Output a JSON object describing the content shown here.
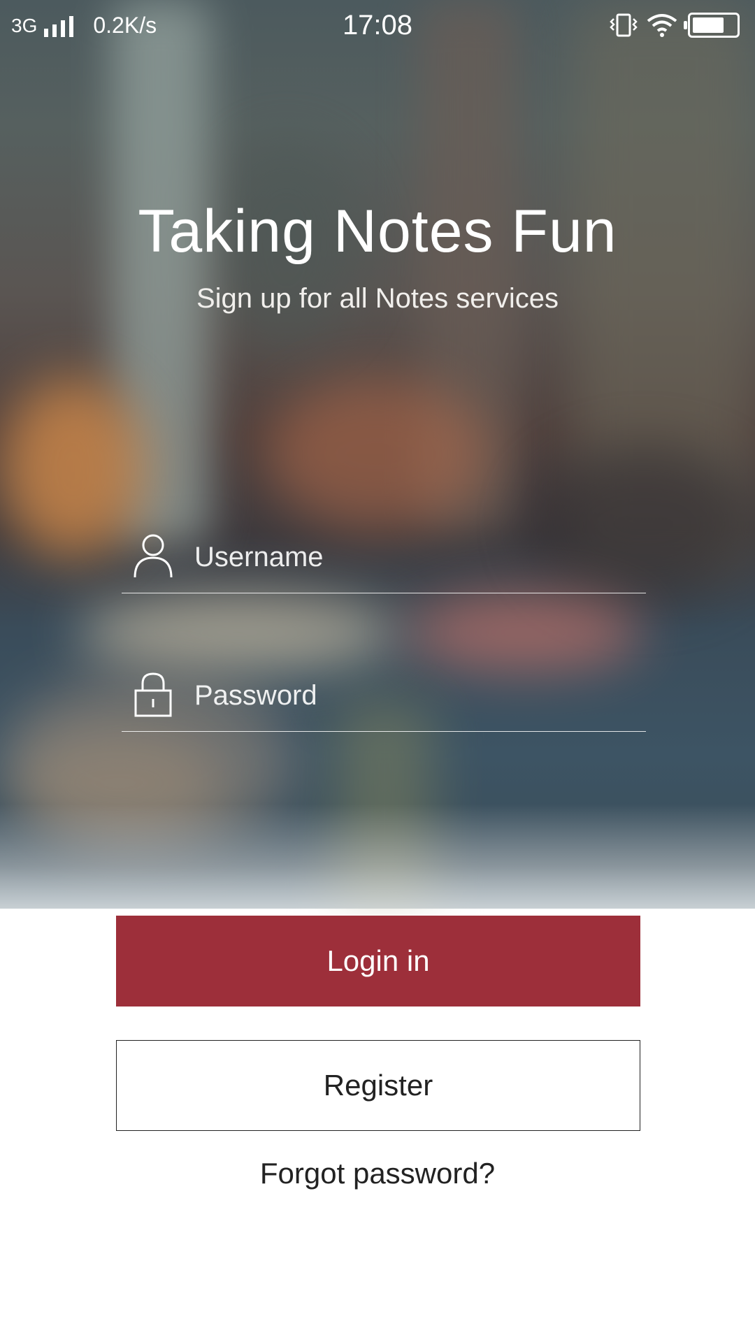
{
  "status_bar": {
    "network": "3G",
    "speed": "0.2K/s",
    "time": "17:08",
    "icons": [
      "signal-icon",
      "vibrate-icon",
      "wifi-icon",
      "battery-icon"
    ]
  },
  "header": {
    "title": "Taking Notes Fun",
    "subtitle": "Sign up for all Notes services"
  },
  "form": {
    "username_placeholder": "Username",
    "username_value": "",
    "password_placeholder": "Password",
    "password_value": ""
  },
  "actions": {
    "login_label": "Login in",
    "register_label": "Register",
    "forgot_label": "Forgot password?"
  },
  "colors": {
    "accent": "#9d2f3a",
    "text_dark": "#222222",
    "text_light": "#ffffff"
  }
}
